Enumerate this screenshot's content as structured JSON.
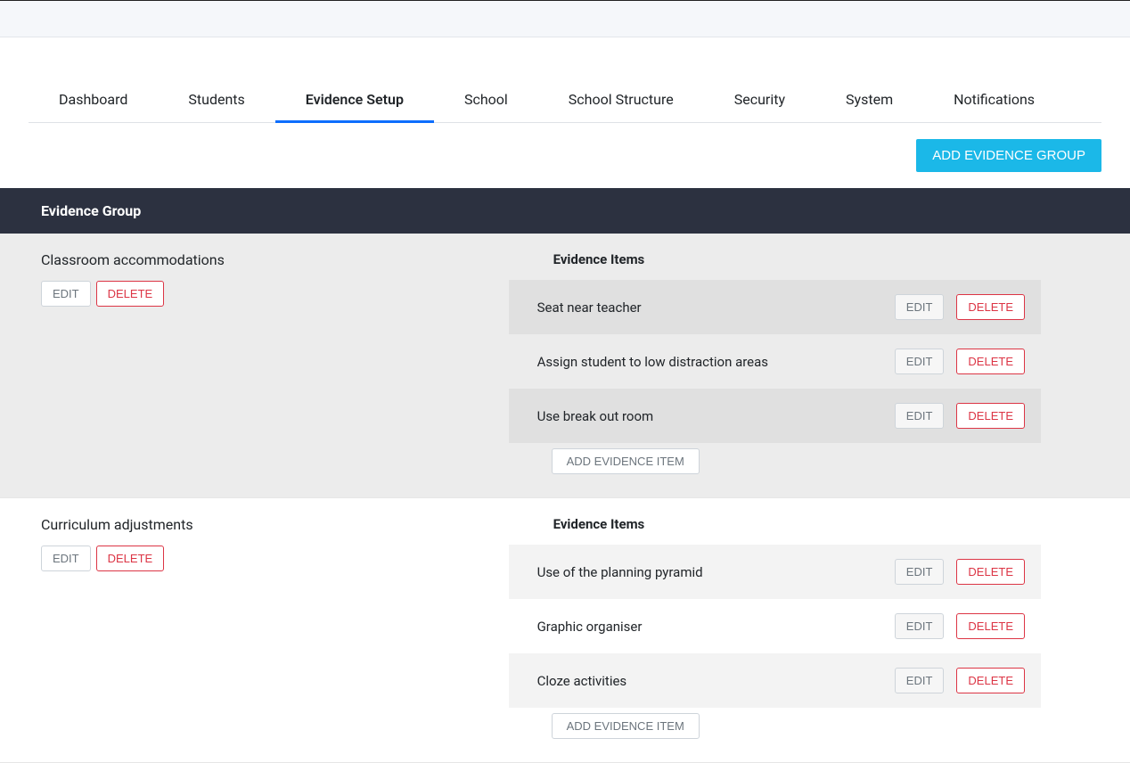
{
  "tabs": [
    {
      "label": "Dashboard",
      "active": false
    },
    {
      "label": "Students",
      "active": false
    },
    {
      "label": "Evidence Setup",
      "active": true
    },
    {
      "label": "School",
      "active": false
    },
    {
      "label": "School Structure",
      "active": false
    },
    {
      "label": "Security",
      "active": false
    },
    {
      "label": "System",
      "active": false
    },
    {
      "label": "Notifications",
      "active": false
    }
  ],
  "buttons": {
    "add_group": "ADD EVIDENCE GROUP",
    "add_item": "ADD EVIDENCE ITEM",
    "edit": "EDIT",
    "delete": "DELETE"
  },
  "header": {
    "group_col": "Evidence Group"
  },
  "items_heading": "Evidence Items",
  "groups": [
    {
      "name": "Classroom accommodations",
      "alt": true,
      "items": [
        {
          "label": "Seat near teacher"
        },
        {
          "label": "Assign student to low distraction areas"
        },
        {
          "label": "Use break out room"
        }
      ]
    },
    {
      "name": "Curriculum adjustments",
      "alt": false,
      "items": [
        {
          "label": "Use of the planning pyramid"
        },
        {
          "label": "Graphic organiser"
        },
        {
          "label": "Cloze activities"
        }
      ]
    }
  ]
}
